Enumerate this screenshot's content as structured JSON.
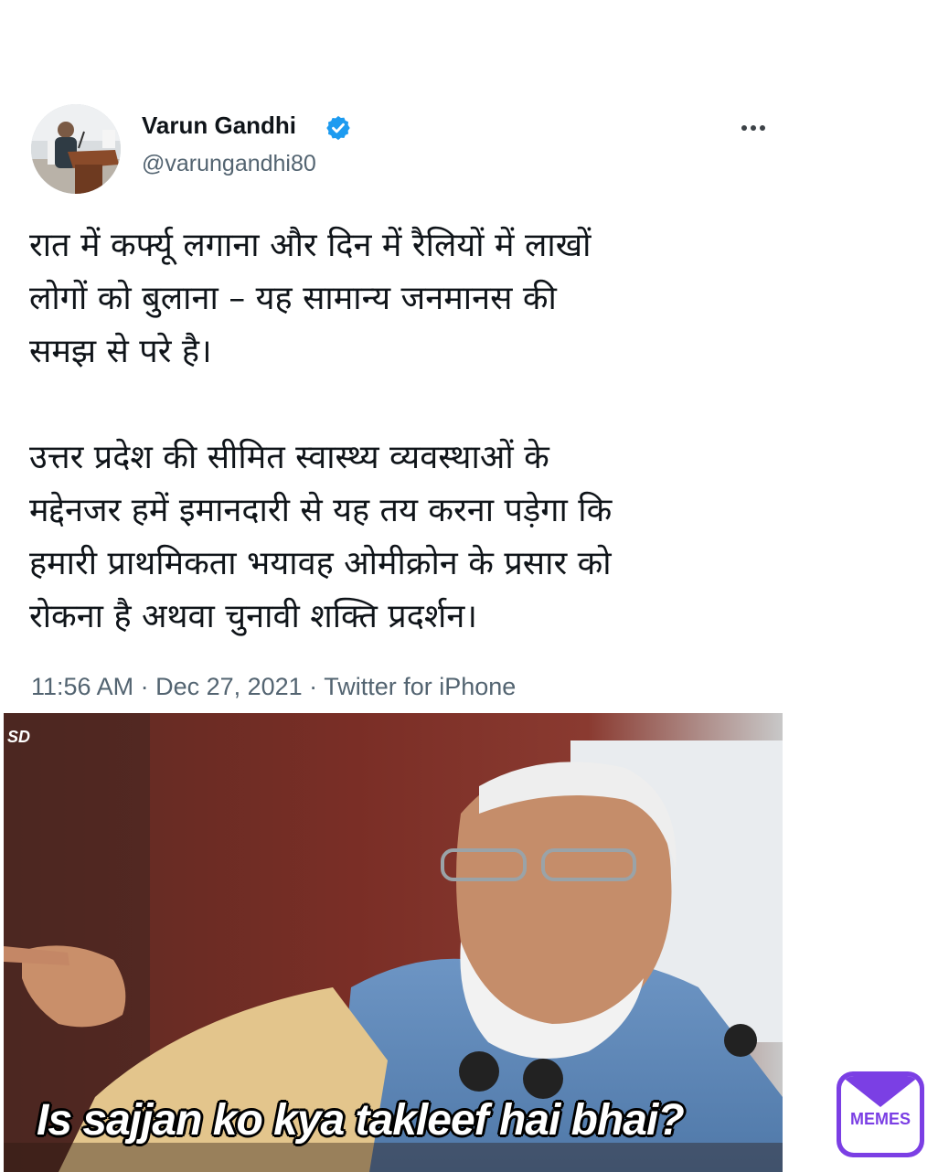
{
  "tweet": {
    "display_name": "Varun Gandhi",
    "handle": "@varungandhi80",
    "verified": true,
    "more_icon": "more-horizontal-icon",
    "paragraphs": [
      [
        "रात में कर्फ्यू लगाना और दिन में रैलियों में लाखों",
        "लोगों को बुलाना – यह सामान्य जनमानस की",
        "समझ से परे है।"
      ],
      [
        "उत्तर प्रदेश की सीमित स्वास्थ्य व्यवस्थाओं के",
        "मद्देनजर हमें इमानदारी से यह तय करना पड़ेगा कि",
        "हमारी प्राथमिकता भयावह ओमीक्रोन के प्रसार को",
        "रोकना है अथवा चुनावी शक्ति प्रदर्शन।"
      ]
    ],
    "timestamp": "11:56 AM · Dec 27, 2021 · Twitter for iPhone"
  },
  "meme": {
    "watermark": "SD",
    "caption": "Is sajjan ko kya takleef hai bhai?"
  },
  "branding": {
    "logo_text": "MEMES",
    "accent": "#7b3fe4"
  },
  "colors": {
    "text": "#0f1419",
    "secondary": "#536471",
    "verified": "#1d9bf0"
  }
}
